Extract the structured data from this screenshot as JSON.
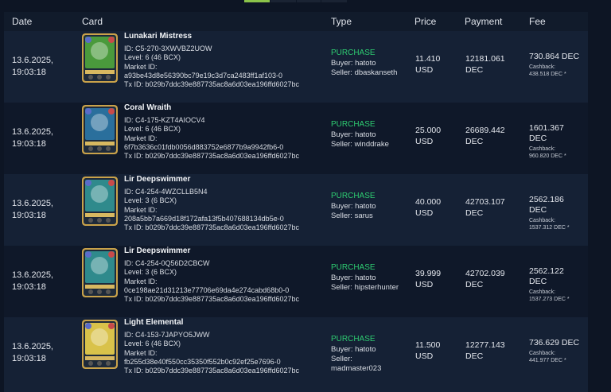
{
  "pager": {
    "segments": 4
  },
  "headers": {
    "date": "Date",
    "card": "Card",
    "type": "Type",
    "price": "Price",
    "payment": "Payment",
    "fee": "Fee"
  },
  "rows": [
    {
      "date1": "13.6.2025,",
      "date2": "19:03:18",
      "name": "Lunakari Mistress",
      "id": "ID: C5-270-3XWVBZ2UOW",
      "level": "Level: 6 (46 BCX)",
      "market_label": "Market ID:",
      "market_id": "a93be43d8e56390bc79e19c3d7ca2483ff1af103-0",
      "tx": "Tx ID: b029b7ddc39e887735ac8a6d03ea196ffd6027bc",
      "type": "PURCHASE",
      "buyer": "Buyer: hatoto",
      "seller": "Seller: dbaskanseth",
      "price": "11.410",
      "price_unit": "USD",
      "payment": "12181.061",
      "payment_unit": "DEC",
      "fee": "730.864 DEC",
      "fee_unit": "",
      "cashback_label": "Cashback:",
      "cashback": "438.518 DEC *",
      "card_color": "#4a9a3c"
    },
    {
      "date1": "13.6.2025,",
      "date2": "19:03:18",
      "name": "Coral Wraith",
      "id": "ID: C4-175-KZT4AIOCV4",
      "level": "Level: 6 (46 BCX)",
      "market_label": "Market ID:",
      "market_id": "6f7b3636c01fdb0056d883752e6877b9a9942fb6-0",
      "tx": "Tx ID: b029b7ddc39e887735ac8a6d03ea196ffd6027bc",
      "type": "PURCHASE",
      "buyer": "Buyer: hatoto",
      "seller": "Seller: winddrake",
      "price": "25.000",
      "price_unit": "USD",
      "payment": "26689.442",
      "payment_unit": "DEC",
      "fee": "1601.367",
      "fee_unit": "DEC",
      "cashback_label": "Cashback:",
      "cashback": "960.820 DEC *",
      "card_color": "#2a6f9c"
    },
    {
      "date1": "13.6.2025,",
      "date2": "19:03:18",
      "name": "Lir Deepswimmer",
      "id": "ID: C4-254-4WZCLLB5N4",
      "level": "Level: 3 (6 BCX)",
      "market_label": "Market ID:",
      "market_id": "208a5bb7a669d18f172afa13f5b407688134db5e-0",
      "tx": "Tx ID: b029b7ddc39e887735ac8a6d03ea196ffd6027bc",
      "type": "PURCHASE",
      "buyer": "Buyer: hatoto",
      "seller": "Seller: sarus",
      "price": "40.000",
      "price_unit": "USD",
      "payment": "42703.107",
      "payment_unit": "DEC",
      "fee": "2562.186",
      "fee_unit": "DEC",
      "cashback_label": "Cashback:",
      "cashback": "1537.312 DEC *",
      "card_color": "#2f8a8c"
    },
    {
      "date1": "13.6.2025,",
      "date2": "19:03:18",
      "name": "Lir Deepswimmer",
      "id": "ID: C4-254-0Q56D2CBCW",
      "level": "Level: 3 (6 BCX)",
      "market_label": "Market ID:",
      "market_id": "0ce198ae21d31213e77706e69da4e274cabd68b0-0",
      "tx": "Tx ID: b029b7ddc39e887735ac8a6d03ea196ffd6027bc",
      "type": "PURCHASE",
      "buyer": "Buyer: hatoto",
      "seller": "Seller: hipsterhunter",
      "price": "39.999",
      "price_unit": "USD",
      "payment": "42702.039",
      "payment_unit": "DEC",
      "fee": "2562.122",
      "fee_unit": "DEC",
      "cashback_label": "Cashback:",
      "cashback": "1537.273 DEC *",
      "card_color": "#2f8a8c"
    },
    {
      "date1": "13.6.2025,",
      "date2": "19:03:18",
      "name": "Light Elemental",
      "id": "ID: C4-153-7JAPYO5JWW",
      "level": "Level: 6 (46 BCX)",
      "market_label": "Market ID:",
      "market_id": "fb255d38e40f550cc35350f552b0c92ef25e7696-0",
      "tx": "Tx ID: b029b7ddc39e887735ac8a6d03ea196ffd6027bc",
      "type": "PURCHASE",
      "buyer": "Buyer: hatoto",
      "seller": "Seller:",
      "seller2": "madmaster023",
      "price": "11.500",
      "price_unit": "USD",
      "payment": "12277.143",
      "payment_unit": "DEC",
      "fee": "736.629 DEC",
      "fee_unit": "",
      "cashback_label": "Cashback:",
      "cashback": "441.977 DEC *",
      "card_color": "#d9c24a"
    }
  ]
}
